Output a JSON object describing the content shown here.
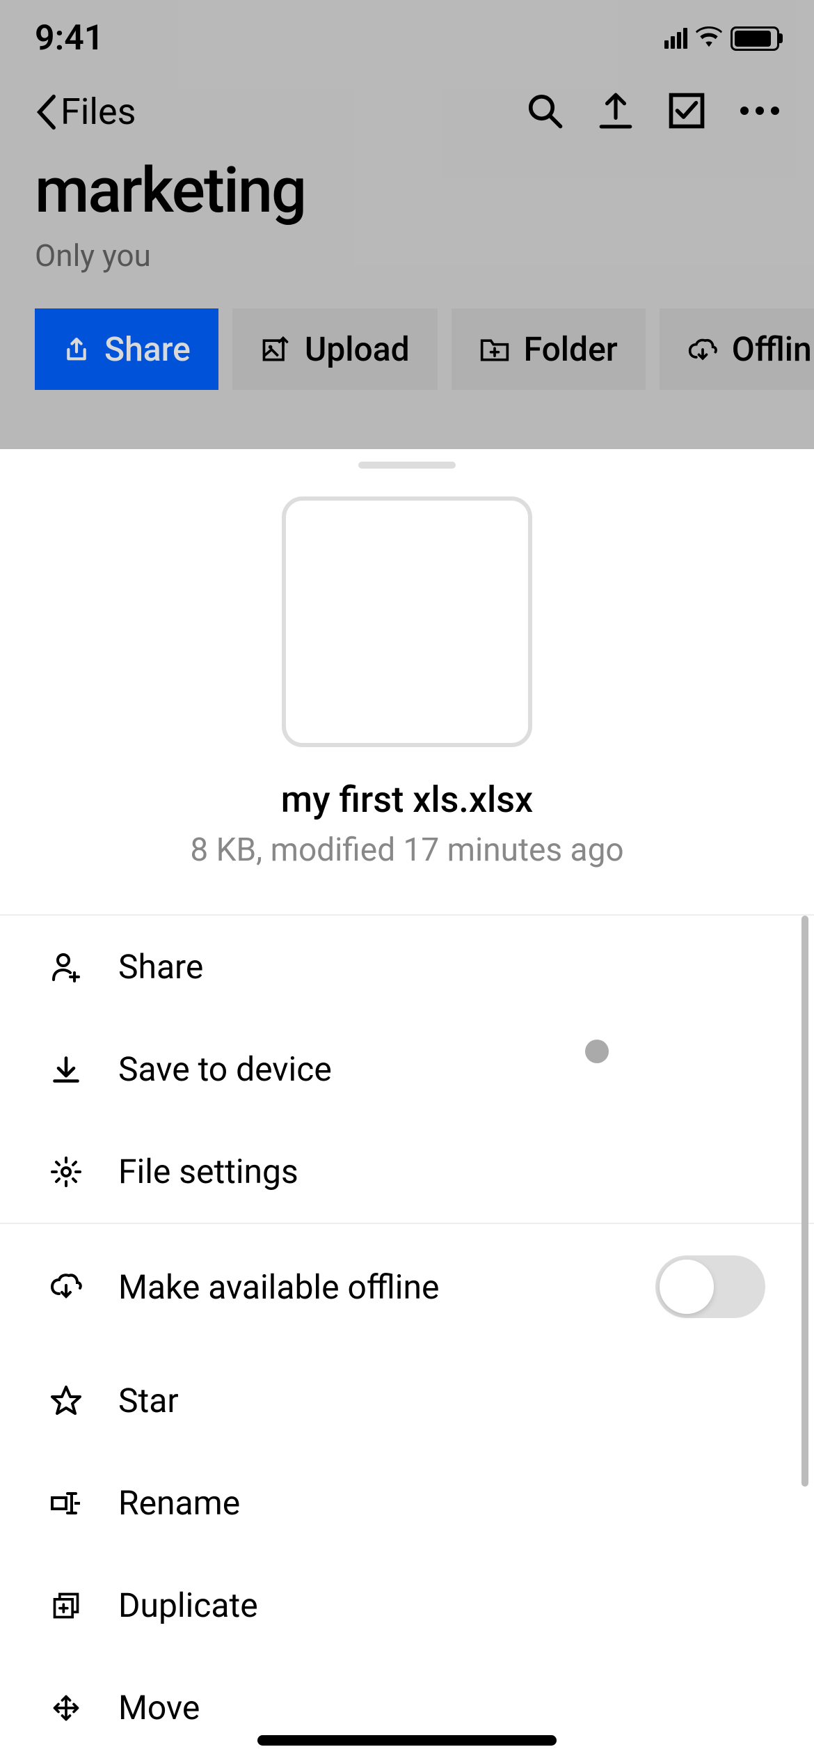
{
  "statusBar": {
    "time": "9:41"
  },
  "nav": {
    "backLabel": "Files"
  },
  "folder": {
    "title": "marketing",
    "subtitle": "Only you"
  },
  "pills": {
    "share": "Share",
    "upload": "Upload",
    "folder": "Folder",
    "offline": "Offlin"
  },
  "sheet": {
    "fileName": "my first xls.xlsx",
    "fileMeta": "8 KB, modified 17 minutes ago",
    "menu": {
      "share": "Share",
      "saveToDevice": "Save to device",
      "fileSettings": "File settings",
      "makeOffline": "Make available offline",
      "star": "Star",
      "rename": "Rename",
      "duplicate": "Duplicate",
      "move": "Move"
    }
  }
}
